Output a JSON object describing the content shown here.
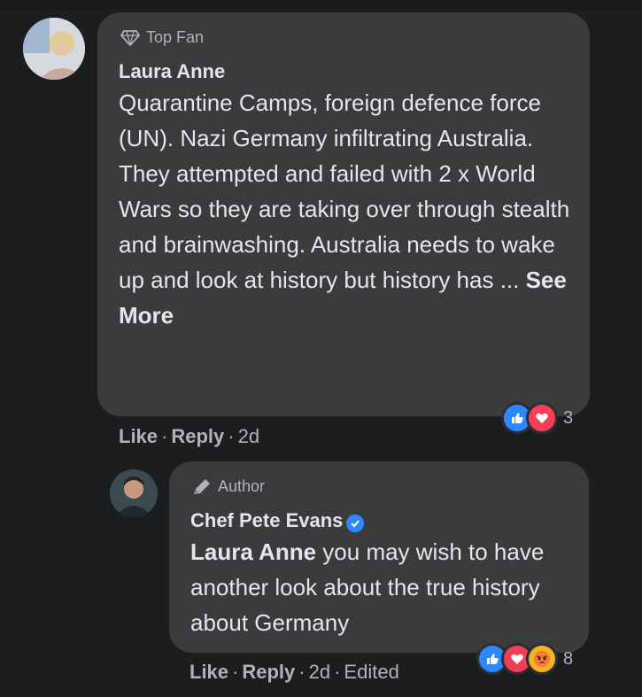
{
  "comment1": {
    "badge": "Top Fan",
    "name": "Laura Anne",
    "text": "Quarantine Camps, foreign defence force (UN). Nazi Germany infiltrating Australia. They attempted and failed with 2 x World Wars so they are taking over through stealth and brainwashing. Australia needs to wake up and look at history but history has ...",
    "see_more": "See More",
    "like": "Like",
    "reply": "Reply",
    "time": "2d",
    "reaction_count": "3",
    "reaction_icons": [
      "like-icon",
      "love-icon"
    ]
  },
  "comment2": {
    "badge": "Author",
    "name": "Chef Pete Evans",
    "mention": "Laura Anne",
    "text": "you may wish to have another look about the true history about Germany",
    "like": "Like",
    "reply": "Reply",
    "time": "2d",
    "edited": "Edited",
    "reaction_count": "8",
    "reaction_icons": [
      "like-icon",
      "love-icon",
      "angry-icon"
    ]
  },
  "colors": {
    "background": "#1c1d1f",
    "bubble": "#3a3b3c",
    "like_blue": "#2d88ff",
    "love_red": "#f33e58",
    "angry_orange": "#f7b125"
  }
}
